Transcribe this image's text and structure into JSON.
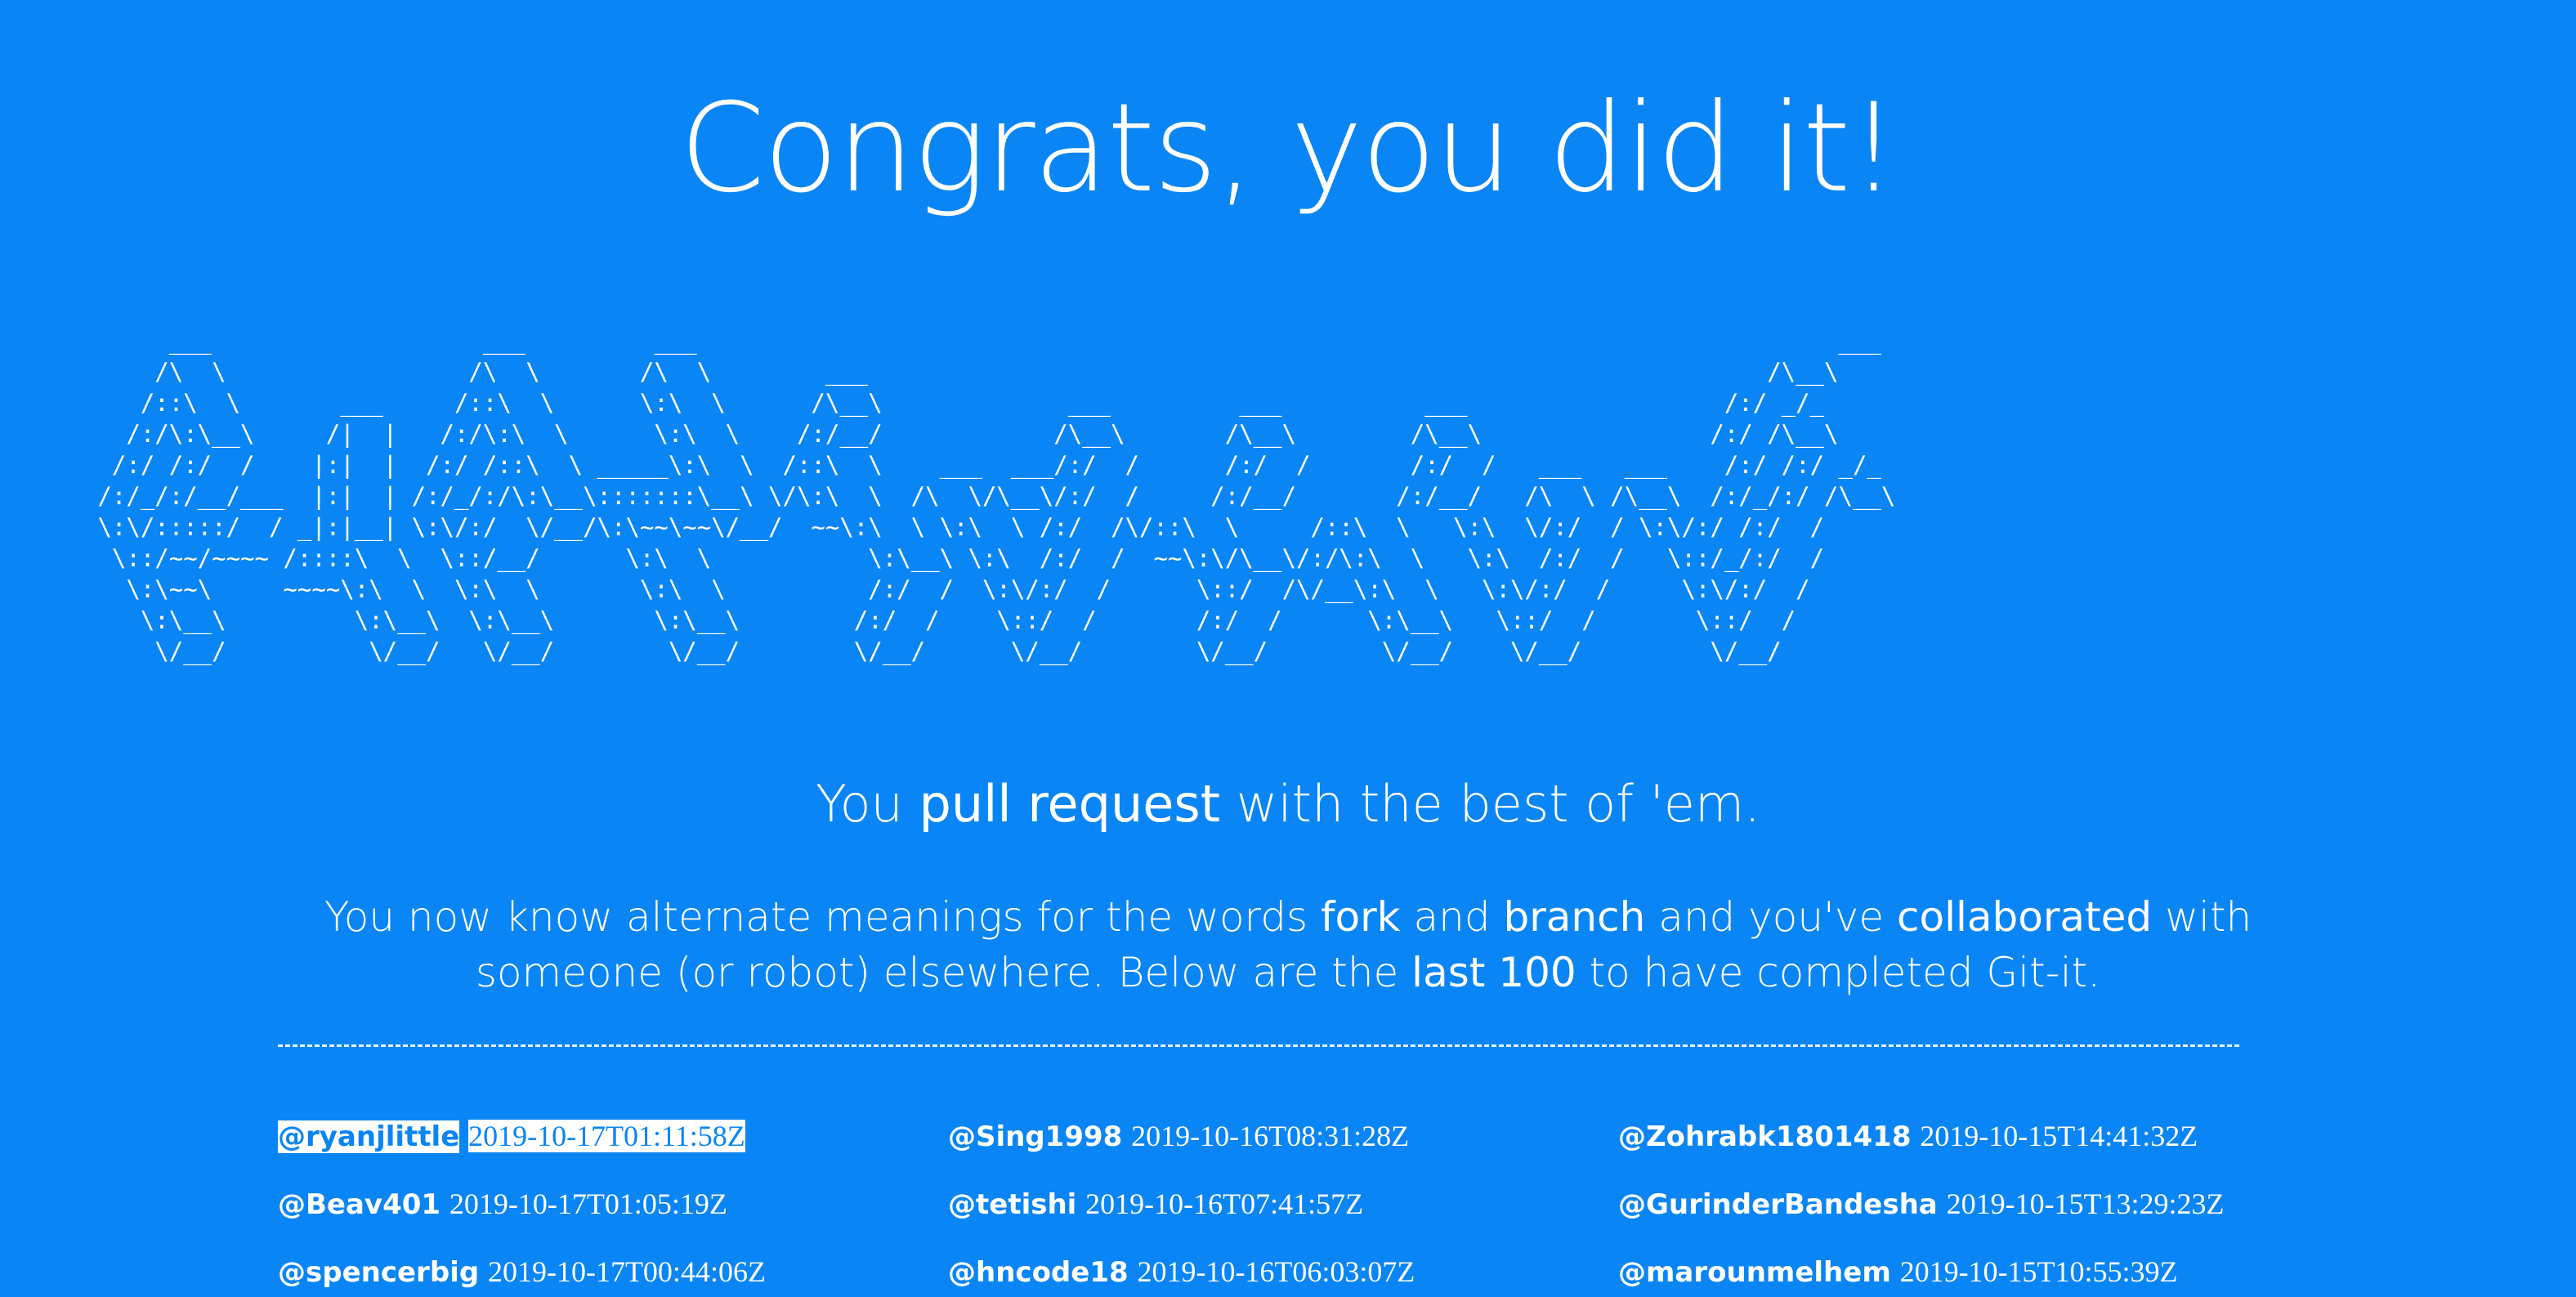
{
  "header": {
    "title": "Congrats, you did it!"
  },
  "ascii_art": "      ___                   ___         ___                                                                                ___     \n     /\\  \\                 /\\  \\       /\\  \\        ___                                                               /\\__\\    \n    /::\\  \\       ___     /::\\  \\      \\:\\  \\      /\\__\\             ___         ___          ___                  /:/ _/_   \n   /:/\\:\\__\\     /|  |   /:/\\:\\  \\      \\:\\  \\    /:/__/            /\\__\\       /\\__\\        /\\__\\                /:/ /\\__\\  \n  /:/ /:/  /    |:|  |  /:/ /::\\  \\ _____\\:\\  \\  /::\\  \\    ___  ___/:/  /      /:/  /       /:/  /   ___   ___    /:/ /:/ _/_ \n /:/_/:/__/___  |:|  | /:/_/:/\\:\\__\\:::::::\\__\\ \\/\\:\\  \\  /\\  \\/\\__\\/:/  /     /:/__/       /:/__/   /\\  \\ /\\__\\  /:/_/:/ /\\__\\\n \\:\\/:::::/  / _|:|__| \\:\\/:/  \\/__/\\:\\~~\\~~\\/__/  ~~\\:\\  \\ \\:\\  \\ /:/  /\\/::\\  \\     /::\\  \\   \\:\\  \\/:/  / \\:\\/:/ /:/  /\n  \\::/~~/~~~~ /::::\\  \\  \\::/__/      \\:\\  \\           \\:\\__\\ \\:\\  /:/  /  ~~\\:\\/\\__\\/:/\\:\\  \\   \\:\\  /:/  /   \\::/_/:/  / \n   \\:\\~~\\     ~~~~\\:\\  \\  \\:\\  \\       \\:\\  \\          /:/  /  \\:\\/:/  /      \\::/  /\\/__\\:\\  \\   \\:\\/:/  /     \\:\\/:/  /  \n    \\:\\__\\         \\:\\__\\  \\:\\__\\       \\:\\__\\        /:/  /    \\::/  /       /:/  /      \\:\\__\\   \\::/  /       \\::/  /   \n     \\/__/          \\/__/   \\/__/        \\/__/        \\/__/      \\/__/        \\/__/        \\/__/    \\/__/         \\/__/    ",
  "tagline": {
    "prefix": "You ",
    "emphasis": "pull request",
    "suffix": " with the best of 'em."
  },
  "description": {
    "p1": "You now know alternate meanings for the words ",
    "b1": "fork",
    "p2": " and ",
    "b2": "branch",
    "p3": " and you've ",
    "b3": "collaborated",
    "p4": " with someone (or robot) elsewhere. Below are the ",
    "b4": "last 100",
    "p5": " to have completed Git-it."
  },
  "completions": [
    {
      "user": "@ryanjlittle",
      "time": "2019-10-17T01:11:58Z",
      "selected": true
    },
    {
      "user": "@Sing1998",
      "time": "2019-10-16T08:31:28Z"
    },
    {
      "user": "@Zohrabk1801418",
      "time": "2019-10-15T14:41:32Z"
    },
    {
      "user": "@Beav401",
      "time": "2019-10-17T01:05:19Z"
    },
    {
      "user": "@tetishi",
      "time": "2019-10-16T07:41:57Z"
    },
    {
      "user": "@GurinderBandesha",
      "time": "2019-10-15T13:29:23Z"
    },
    {
      "user": "@spencerbig",
      "time": "2019-10-17T00:44:06Z"
    },
    {
      "user": "@hncode18",
      "time": "2019-10-16T06:03:07Z"
    },
    {
      "user": "@marounmelhem",
      "time": "2019-10-15T10:55:39Z"
    }
  ]
}
